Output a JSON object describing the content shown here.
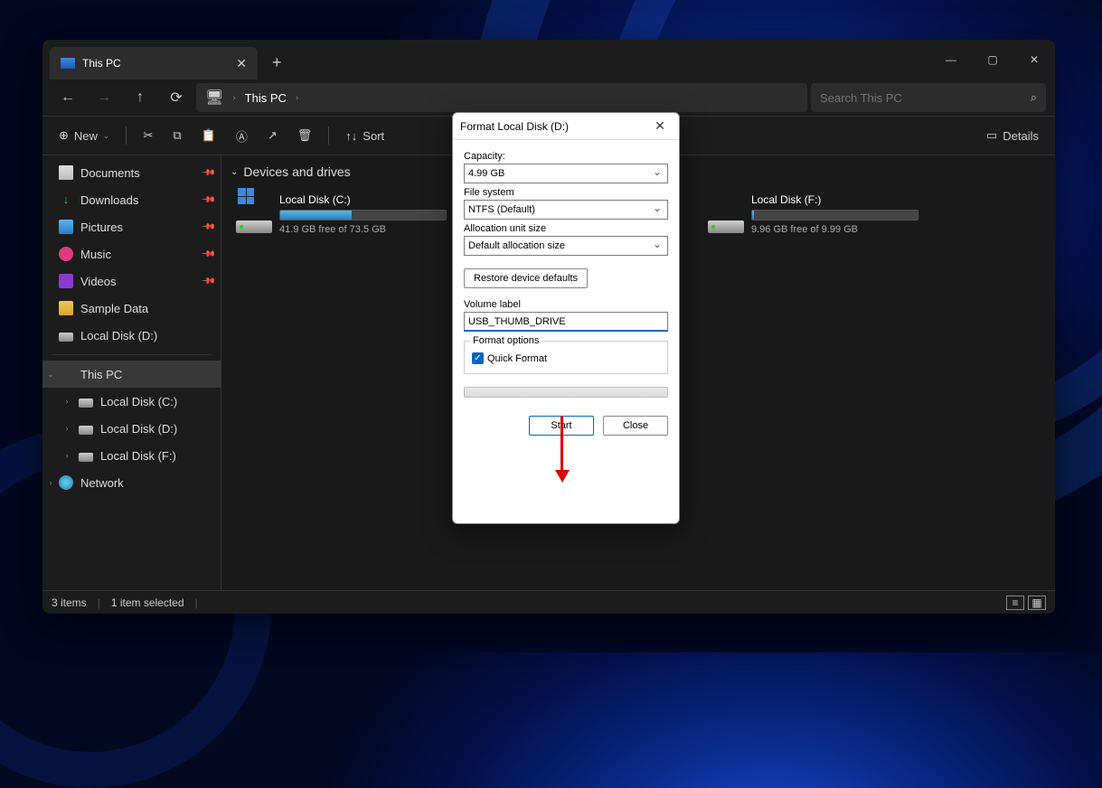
{
  "window": {
    "tab_title": "This PC",
    "new_tab_symbol": "+",
    "controls": {
      "min": "—",
      "max": "▢",
      "close": "✕"
    }
  },
  "navbar": {
    "back": "←",
    "forward": "→",
    "up": "↑",
    "refresh": "⟳",
    "address_icon": "🖥",
    "chev": "›",
    "location": "This PC",
    "search_placeholder": "Search This PC",
    "search_icon": "⌕"
  },
  "toolbar": {
    "new_label": "New",
    "new_icon": "⊕",
    "cut": "✂",
    "copy": "⧉",
    "paste": "📋",
    "rename": "Ⓐ",
    "share": "↗",
    "delete": "🗑",
    "sort_label": "Sort",
    "sort_icon": "↑↓",
    "details_label": "Details",
    "details_icon": "▭"
  },
  "sidebar": {
    "items": [
      {
        "icon": "doc",
        "label": "Documents",
        "pin": true
      },
      {
        "icon": "dl",
        "label": "Downloads",
        "pin": true
      },
      {
        "icon": "pic",
        "label": "Pictures",
        "pin": true
      },
      {
        "icon": "music",
        "label": "Music",
        "pin": true
      },
      {
        "icon": "video",
        "label": "Videos",
        "pin": true
      },
      {
        "icon": "folder",
        "label": "Sample Data",
        "pin": false
      },
      {
        "icon": "drive",
        "label": "Local Disk (D:)",
        "pin": false
      }
    ],
    "this_pc_label": "This PC",
    "tree": [
      {
        "label": "Local Disk (C:)"
      },
      {
        "label": "Local Disk (D:)"
      },
      {
        "label": "Local Disk (F:)"
      }
    ],
    "network_label": "Network"
  },
  "main": {
    "group": "Devices and drives",
    "drives": [
      {
        "name": "Local Disk (C:)",
        "free_text": "41.9 GB free of 73.5 GB",
        "fill_pct": 43,
        "os": true
      },
      {
        "name": "",
        "free_text": "",
        "fill_pct": 0,
        "os": false
      },
      {
        "name": "Local Disk (F:)",
        "free_text": "9.96 GB free of 9.99 GB",
        "fill_pct": 1,
        "os": false
      }
    ]
  },
  "statusbar": {
    "count": "3 items",
    "selection": "1 item selected"
  },
  "dialog": {
    "title": "Format Local Disk (D:)",
    "capacity_label": "Capacity:",
    "capacity_value": "4.99 GB",
    "fs_label": "File system",
    "fs_value": "NTFS (Default)",
    "alloc_label": "Allocation unit size",
    "alloc_value": "Default allocation size",
    "restore_btn": "Restore device defaults",
    "vol_label": "Volume label",
    "vol_value": "USB_THUMB_DRIVE",
    "options_legend": "Format options",
    "quick_format": "Quick Format",
    "start_btn": "Start",
    "close_btn": "Close",
    "close_x": "✕"
  }
}
